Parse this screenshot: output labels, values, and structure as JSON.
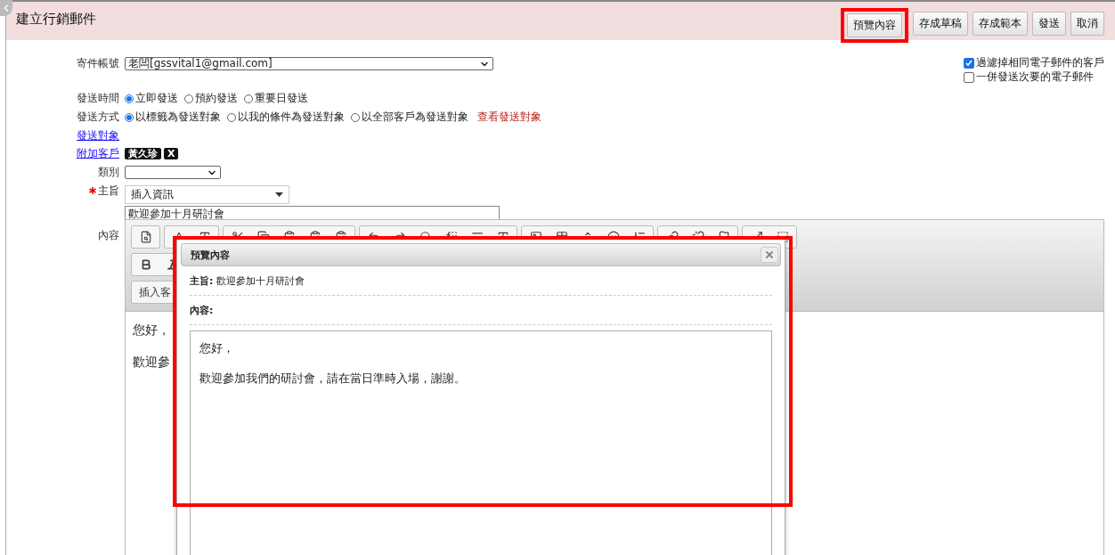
{
  "header": {
    "title": "建立行銷郵件",
    "buttons": [
      {
        "label": "預覽內容",
        "highlighted": true
      },
      {
        "label": "存成草稿",
        "highlighted": false
      },
      {
        "label": "存成範本",
        "highlighted": false
      },
      {
        "label": "發送",
        "highlighted": false
      },
      {
        "label": "取消",
        "highlighted": false
      }
    ]
  },
  "form": {
    "sender": {
      "label": "寄件帳號",
      "value": "老闆[gssvital1@gmail.com]"
    },
    "options": [
      {
        "label": "過濾掉相同電子郵件的客戶",
        "checked": true
      },
      {
        "label": "一併發送次要的電子郵件",
        "checked": false
      }
    ],
    "send_time": {
      "label": "發送時間",
      "choices": [
        {
          "label": "立即發送",
          "selected": true
        },
        {
          "label": "預約發送",
          "selected": false
        },
        {
          "label": "重要日發送",
          "selected": false
        }
      ]
    },
    "send_method": {
      "label": "發送方式",
      "choices": [
        {
          "label": "以標籤為發送對象",
          "selected": true
        },
        {
          "label": "以我的條件為發送對象",
          "selected": false
        },
        {
          "label": "以全部客戶為發送對象",
          "selected": false
        }
      ],
      "link": "查看發送對象"
    },
    "recipients_link": "發送對象",
    "attach_customers": {
      "link": "附加客戶",
      "tags": [
        {
          "name": "黃久珍",
          "remove": "X"
        }
      ]
    },
    "category": {
      "label": "類別"
    },
    "subject": {
      "label": "主旨",
      "required": true,
      "insert_menu": "插入資訊",
      "value": "歡迎參加十月研討會"
    },
    "content": {
      "label": "內容",
      "insert_button": "插入客",
      "lines": [
        "您好，",
        "歡迎參"
      ]
    }
  },
  "preview_dialog": {
    "title": "預覽內容",
    "highlighted": true,
    "subject_label": "主旨:",
    "subject": "歡迎參加十月研討會",
    "content_label": "內容:",
    "paragraphs": [
      "您好，",
      "歡迎參加我們的研討會，請在當日準時入場，謝謝。"
    ]
  }
}
